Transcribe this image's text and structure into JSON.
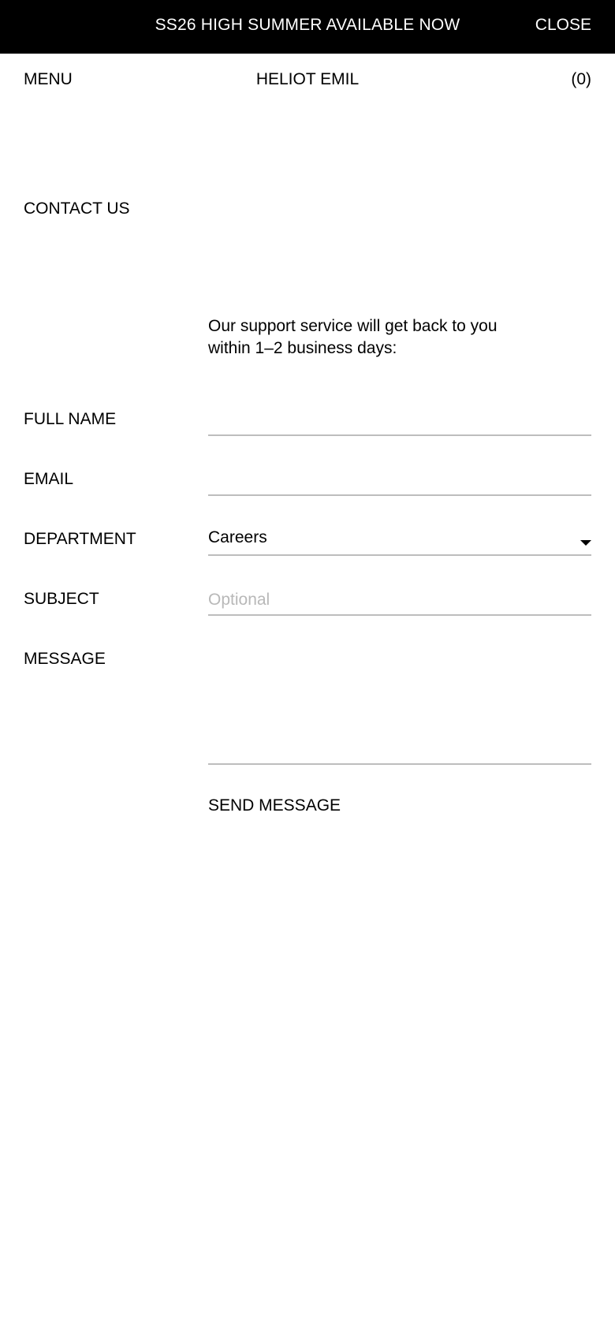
{
  "banner": {
    "text": "SS26 HIGH SUMMER AVAILABLE NOW",
    "close_label": "CLOSE"
  },
  "nav": {
    "menu_label": "MENU",
    "brand": "HELIOT EMIL",
    "cart_label": "(0)"
  },
  "page": {
    "title": "CONTACT US",
    "intro": "Our support service will get back to you within 1–2 business days:"
  },
  "form": {
    "full_name_label": "FULL NAME",
    "full_name_value": "",
    "email_label": "EMAIL",
    "email_value": "",
    "department_label": "DEPARTMENT",
    "department_value": "Careers",
    "subject_label": "SUBJECT",
    "subject_placeholder": "Optional",
    "message_label": "MESSAGE",
    "message_value": "",
    "send_label": "SEND MESSAGE"
  },
  "icons": {
    "dropdown": "chevron-down-icon"
  },
  "colors": {
    "banner_bg": "#000000",
    "banner_text": "#ffffff",
    "field_border": "#bdbdbd",
    "placeholder": "#b8b8b8"
  }
}
